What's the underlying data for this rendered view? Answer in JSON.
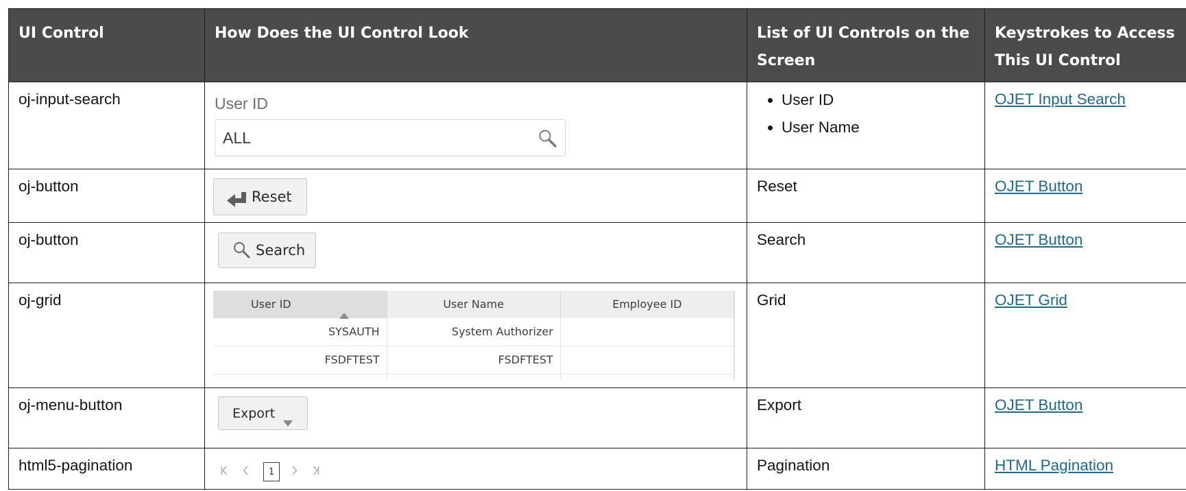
{
  "headers": [
    "UI Control",
    "How Does the UI Control Look",
    "List of UI Controls on the Screen",
    "Keystrokes to Access This UI Control"
  ],
  "rows": [
    {
      "control": "oj-input-search",
      "screen_controls": [
        "User ID",
        "User Name"
      ],
      "link": "OJET Input Search"
    },
    {
      "control": "oj-button",
      "screen_controls": "Reset",
      "link": "OJET Button"
    },
    {
      "control": "oj-button",
      "screen_controls": "Search",
      "link": "OJET Button"
    },
    {
      "control": "oj-grid",
      "screen_controls": "Grid",
      "link": "OJET Grid"
    },
    {
      "control": "oj-menu-button",
      "screen_controls": "Export",
      "link": "OJET Button"
    },
    {
      "control": "html5-pagination",
      "screen_controls": "Pagination",
      "link": "HTML Pagination"
    }
  ],
  "samples": {
    "input_search": {
      "label": "User ID",
      "value": "ALL",
      "icon": "search-icon"
    },
    "reset_button": {
      "label": "Reset",
      "icon": "return-arrow-icon"
    },
    "search_button": {
      "label": "Search",
      "icon": "search-icon"
    },
    "grid": {
      "columns": [
        "User ID",
        "User Name",
        "Employee ID"
      ],
      "sort_icon": "sort-ascending-icon",
      "rows": [
        [
          "SYSAUTH",
          "System Authorizer",
          ""
        ],
        [
          "FSDFTEST",
          "FSDFTEST",
          ""
        ]
      ]
    },
    "export_button": {
      "label": "Export",
      "icon": "caret-down-icon"
    },
    "pagination": {
      "first": "K",
      "prev": "<",
      "page": "1",
      "next": ">",
      "last": "→|"
    }
  },
  "colors": {
    "header_bg": "#4b4b4b",
    "link": "#1f6a8a",
    "border": "#1d1d1d"
  }
}
